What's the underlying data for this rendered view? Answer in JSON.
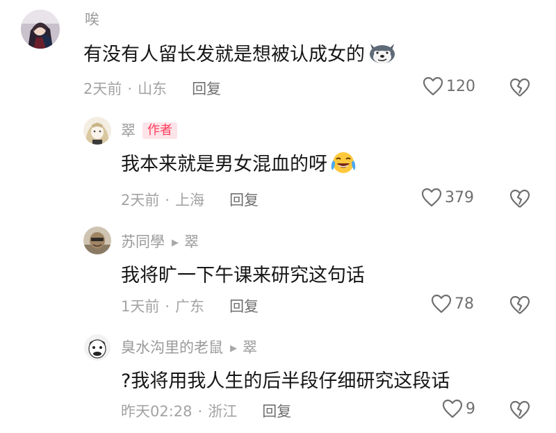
{
  "comments": [
    {
      "user": "唉",
      "text": "有没有人留长发就是想被认成女的",
      "emoji": "husky-emoji",
      "time": "2天前",
      "location": "山东",
      "reply_label": "回复",
      "likes": "120"
    },
    {
      "user": "翠",
      "author_tag": "作者",
      "text": "我本来就是男女混血的呀",
      "emoji": "laugh-cry-emoji",
      "time": "2天前",
      "location": "上海",
      "reply_label": "回复",
      "likes": "379"
    },
    {
      "user": "苏同學",
      "reply_to": "翠",
      "text": "我将旷一下午课来研究这句话",
      "time": "1天前",
      "location": "广东",
      "reply_label": "回复",
      "likes": "78"
    },
    {
      "user": "臭水沟里的老鼠",
      "reply_to": "翠",
      "text": "?我将用我人生的后半段仔细研究这段话",
      "time": "昨天02:28",
      "location": "浙江",
      "reply_label": "回复",
      "likes": "9"
    }
  ],
  "separator": "·",
  "icons": {
    "like": "heart-outline-icon",
    "dislike": "broken-heart-icon",
    "reply_arrow": "triangle-right-icon"
  },
  "colors": {
    "author_tag_text": "#ff3b5c",
    "author_tag_bg": "#fde4e8",
    "meta_gray": "#a3a3a3"
  }
}
